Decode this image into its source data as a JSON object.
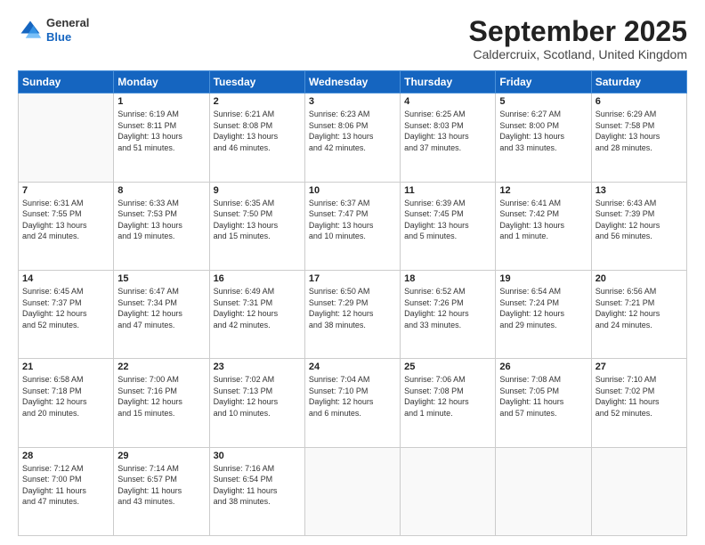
{
  "logo": {
    "general": "General",
    "blue": "Blue"
  },
  "title": "September 2025",
  "location": "Caldercruix, Scotland, United Kingdom",
  "weekdays": [
    "Sunday",
    "Monday",
    "Tuesday",
    "Wednesday",
    "Thursday",
    "Friday",
    "Saturday"
  ],
  "weeks": [
    [
      {
        "day": "",
        "info": ""
      },
      {
        "day": "1",
        "info": "Sunrise: 6:19 AM\nSunset: 8:11 PM\nDaylight: 13 hours\nand 51 minutes."
      },
      {
        "day": "2",
        "info": "Sunrise: 6:21 AM\nSunset: 8:08 PM\nDaylight: 13 hours\nand 46 minutes."
      },
      {
        "day": "3",
        "info": "Sunrise: 6:23 AM\nSunset: 8:06 PM\nDaylight: 13 hours\nand 42 minutes."
      },
      {
        "day": "4",
        "info": "Sunrise: 6:25 AM\nSunset: 8:03 PM\nDaylight: 13 hours\nand 37 minutes."
      },
      {
        "day": "5",
        "info": "Sunrise: 6:27 AM\nSunset: 8:00 PM\nDaylight: 13 hours\nand 33 minutes."
      },
      {
        "day": "6",
        "info": "Sunrise: 6:29 AM\nSunset: 7:58 PM\nDaylight: 13 hours\nand 28 minutes."
      }
    ],
    [
      {
        "day": "7",
        "info": "Sunrise: 6:31 AM\nSunset: 7:55 PM\nDaylight: 13 hours\nand 24 minutes."
      },
      {
        "day": "8",
        "info": "Sunrise: 6:33 AM\nSunset: 7:53 PM\nDaylight: 13 hours\nand 19 minutes."
      },
      {
        "day": "9",
        "info": "Sunrise: 6:35 AM\nSunset: 7:50 PM\nDaylight: 13 hours\nand 15 minutes."
      },
      {
        "day": "10",
        "info": "Sunrise: 6:37 AM\nSunset: 7:47 PM\nDaylight: 13 hours\nand 10 minutes."
      },
      {
        "day": "11",
        "info": "Sunrise: 6:39 AM\nSunset: 7:45 PM\nDaylight: 13 hours\nand 5 minutes."
      },
      {
        "day": "12",
        "info": "Sunrise: 6:41 AM\nSunset: 7:42 PM\nDaylight: 13 hours\nand 1 minute."
      },
      {
        "day": "13",
        "info": "Sunrise: 6:43 AM\nSunset: 7:39 PM\nDaylight: 12 hours\nand 56 minutes."
      }
    ],
    [
      {
        "day": "14",
        "info": "Sunrise: 6:45 AM\nSunset: 7:37 PM\nDaylight: 12 hours\nand 52 minutes."
      },
      {
        "day": "15",
        "info": "Sunrise: 6:47 AM\nSunset: 7:34 PM\nDaylight: 12 hours\nand 47 minutes."
      },
      {
        "day": "16",
        "info": "Sunrise: 6:49 AM\nSunset: 7:31 PM\nDaylight: 12 hours\nand 42 minutes."
      },
      {
        "day": "17",
        "info": "Sunrise: 6:50 AM\nSunset: 7:29 PM\nDaylight: 12 hours\nand 38 minutes."
      },
      {
        "day": "18",
        "info": "Sunrise: 6:52 AM\nSunset: 7:26 PM\nDaylight: 12 hours\nand 33 minutes."
      },
      {
        "day": "19",
        "info": "Sunrise: 6:54 AM\nSunset: 7:24 PM\nDaylight: 12 hours\nand 29 minutes."
      },
      {
        "day": "20",
        "info": "Sunrise: 6:56 AM\nSunset: 7:21 PM\nDaylight: 12 hours\nand 24 minutes."
      }
    ],
    [
      {
        "day": "21",
        "info": "Sunrise: 6:58 AM\nSunset: 7:18 PM\nDaylight: 12 hours\nand 20 minutes."
      },
      {
        "day": "22",
        "info": "Sunrise: 7:00 AM\nSunset: 7:16 PM\nDaylight: 12 hours\nand 15 minutes."
      },
      {
        "day": "23",
        "info": "Sunrise: 7:02 AM\nSunset: 7:13 PM\nDaylight: 12 hours\nand 10 minutes."
      },
      {
        "day": "24",
        "info": "Sunrise: 7:04 AM\nSunset: 7:10 PM\nDaylight: 12 hours\nand 6 minutes."
      },
      {
        "day": "25",
        "info": "Sunrise: 7:06 AM\nSunset: 7:08 PM\nDaylight: 12 hours\nand 1 minute."
      },
      {
        "day": "26",
        "info": "Sunrise: 7:08 AM\nSunset: 7:05 PM\nDaylight: 11 hours\nand 57 minutes."
      },
      {
        "day": "27",
        "info": "Sunrise: 7:10 AM\nSunset: 7:02 PM\nDaylight: 11 hours\nand 52 minutes."
      }
    ],
    [
      {
        "day": "28",
        "info": "Sunrise: 7:12 AM\nSunset: 7:00 PM\nDaylight: 11 hours\nand 47 minutes."
      },
      {
        "day": "29",
        "info": "Sunrise: 7:14 AM\nSunset: 6:57 PM\nDaylight: 11 hours\nand 43 minutes."
      },
      {
        "day": "30",
        "info": "Sunrise: 7:16 AM\nSunset: 6:54 PM\nDaylight: 11 hours\nand 38 minutes."
      },
      {
        "day": "",
        "info": ""
      },
      {
        "day": "",
        "info": ""
      },
      {
        "day": "",
        "info": ""
      },
      {
        "day": "",
        "info": ""
      }
    ]
  ]
}
